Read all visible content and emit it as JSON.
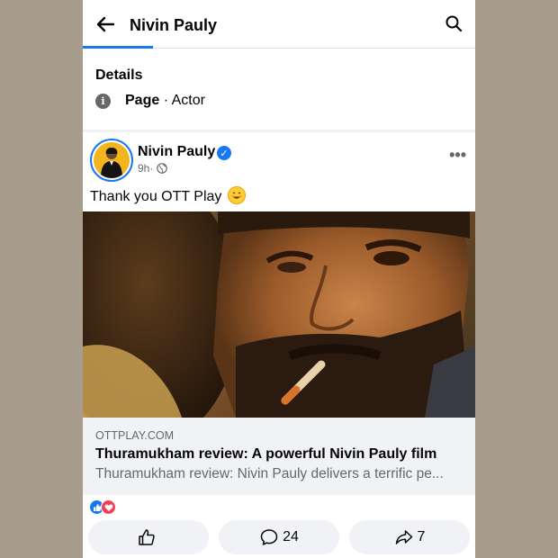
{
  "header": {
    "title": "Nivin Pauly"
  },
  "details": {
    "heading": "Details",
    "page_label": "Page",
    "separator": " · ",
    "category": "Actor"
  },
  "post": {
    "author": "Nivin Pauly",
    "time": "9h",
    "meta_separator": " · ",
    "text": "Thank you OTT Play",
    "link": {
      "domain": "OTTPLAY.COM",
      "title": "Thuramukham review: A powerful Nivin Pauly film",
      "description": "Thuramukham review: Nivin Pauly delivers a terrific pe..."
    },
    "reactions": [
      "like-icon",
      "love-icon"
    ],
    "actions": {
      "comments": "24",
      "shares": "7"
    }
  },
  "colors": {
    "accent": "#1877f2",
    "love": "#f33e58",
    "background": "#a89d8d"
  }
}
